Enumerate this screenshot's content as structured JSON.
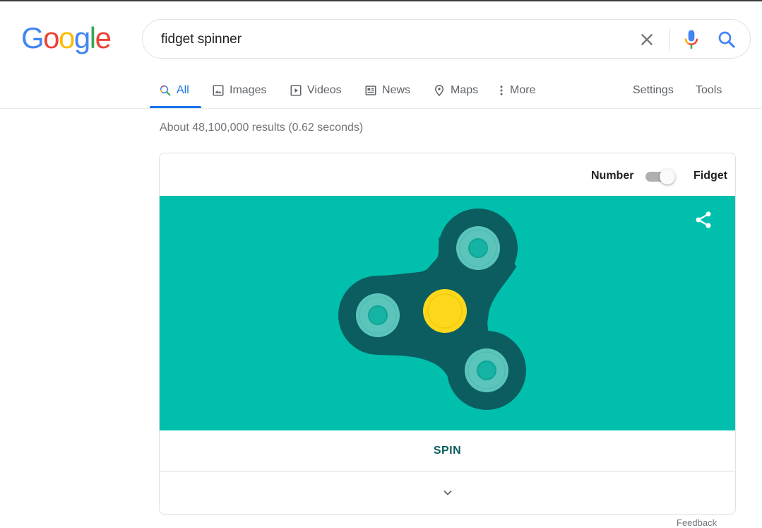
{
  "logo": {
    "letters": [
      "G",
      "o",
      "o",
      "g",
      "l",
      "e"
    ],
    "colors": [
      "#4285f4",
      "#ea4335",
      "#fbbc05",
      "#4285f4",
      "#34a853",
      "#ea4335"
    ]
  },
  "search": {
    "query": "fidget spinner",
    "clear_icon": "close-icon",
    "mic_icon": "microphone-icon",
    "search_icon": "search-icon"
  },
  "tabs": [
    {
      "label": "All",
      "icon": "search-icon",
      "active": true
    },
    {
      "label": "Images",
      "icon": "image-icon",
      "active": false
    },
    {
      "label": "Videos",
      "icon": "play-icon",
      "active": false
    },
    {
      "label": "News",
      "icon": "news-icon",
      "active": false
    },
    {
      "label": "Maps",
      "icon": "map-pin-icon",
      "active": false
    },
    {
      "label": "More",
      "icon": "more-vert-icon",
      "active": false
    }
  ],
  "tools": {
    "settings": "Settings",
    "tools": "Tools"
  },
  "result_stats": "About 48,100,000 results (0.62 seconds)",
  "widget": {
    "toggle_left_label": "Number",
    "toggle_right_label": "Fidget",
    "toggle_state": "Fidget",
    "share_icon": "share-icon",
    "spin_label": "SPIN",
    "expand_icon": "chevron-down-icon",
    "colors": {
      "stage": "#00bfad",
      "body": "#0c5d60",
      "bearing_ring": "#5bc4bb",
      "bearing_inner": "#14b3a3",
      "hub": "#fdd81a",
      "accent": "#1a73e8"
    }
  },
  "footer": {
    "feedback": "Feedback"
  }
}
